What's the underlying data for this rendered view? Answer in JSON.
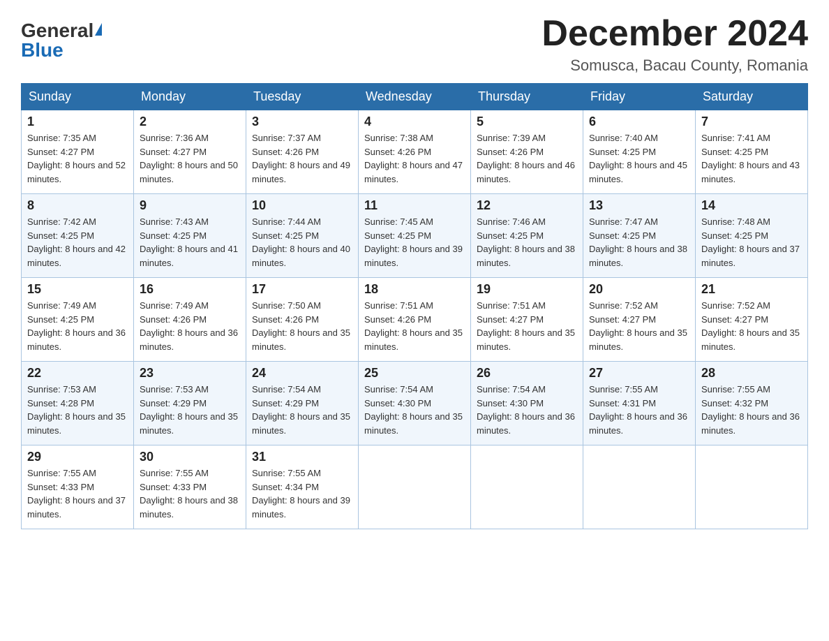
{
  "header": {
    "logo_general": "General",
    "logo_blue": "Blue",
    "month_title": "December 2024",
    "location": "Somusca, Bacau County, Romania"
  },
  "days_of_week": [
    "Sunday",
    "Monday",
    "Tuesday",
    "Wednesday",
    "Thursday",
    "Friday",
    "Saturday"
  ],
  "weeks": [
    [
      {
        "day": "1",
        "sunrise": "7:35 AM",
        "sunset": "4:27 PM",
        "daylight": "8 hours and 52 minutes."
      },
      {
        "day": "2",
        "sunrise": "7:36 AM",
        "sunset": "4:27 PM",
        "daylight": "8 hours and 50 minutes."
      },
      {
        "day": "3",
        "sunrise": "7:37 AM",
        "sunset": "4:26 PM",
        "daylight": "8 hours and 49 minutes."
      },
      {
        "day": "4",
        "sunrise": "7:38 AM",
        "sunset": "4:26 PM",
        "daylight": "8 hours and 47 minutes."
      },
      {
        "day": "5",
        "sunrise": "7:39 AM",
        "sunset": "4:26 PM",
        "daylight": "8 hours and 46 minutes."
      },
      {
        "day": "6",
        "sunrise": "7:40 AM",
        "sunset": "4:25 PM",
        "daylight": "8 hours and 45 minutes."
      },
      {
        "day": "7",
        "sunrise": "7:41 AM",
        "sunset": "4:25 PM",
        "daylight": "8 hours and 43 minutes."
      }
    ],
    [
      {
        "day": "8",
        "sunrise": "7:42 AM",
        "sunset": "4:25 PM",
        "daylight": "8 hours and 42 minutes."
      },
      {
        "day": "9",
        "sunrise": "7:43 AM",
        "sunset": "4:25 PM",
        "daylight": "8 hours and 41 minutes."
      },
      {
        "day": "10",
        "sunrise": "7:44 AM",
        "sunset": "4:25 PM",
        "daylight": "8 hours and 40 minutes."
      },
      {
        "day": "11",
        "sunrise": "7:45 AM",
        "sunset": "4:25 PM",
        "daylight": "8 hours and 39 minutes."
      },
      {
        "day": "12",
        "sunrise": "7:46 AM",
        "sunset": "4:25 PM",
        "daylight": "8 hours and 38 minutes."
      },
      {
        "day": "13",
        "sunrise": "7:47 AM",
        "sunset": "4:25 PM",
        "daylight": "8 hours and 38 minutes."
      },
      {
        "day": "14",
        "sunrise": "7:48 AM",
        "sunset": "4:25 PM",
        "daylight": "8 hours and 37 minutes."
      }
    ],
    [
      {
        "day": "15",
        "sunrise": "7:49 AM",
        "sunset": "4:25 PM",
        "daylight": "8 hours and 36 minutes."
      },
      {
        "day": "16",
        "sunrise": "7:49 AM",
        "sunset": "4:26 PM",
        "daylight": "8 hours and 36 minutes."
      },
      {
        "day": "17",
        "sunrise": "7:50 AM",
        "sunset": "4:26 PM",
        "daylight": "8 hours and 35 minutes."
      },
      {
        "day": "18",
        "sunrise": "7:51 AM",
        "sunset": "4:26 PM",
        "daylight": "8 hours and 35 minutes."
      },
      {
        "day": "19",
        "sunrise": "7:51 AM",
        "sunset": "4:27 PM",
        "daylight": "8 hours and 35 minutes."
      },
      {
        "day": "20",
        "sunrise": "7:52 AM",
        "sunset": "4:27 PM",
        "daylight": "8 hours and 35 minutes."
      },
      {
        "day": "21",
        "sunrise": "7:52 AM",
        "sunset": "4:27 PM",
        "daylight": "8 hours and 35 minutes."
      }
    ],
    [
      {
        "day": "22",
        "sunrise": "7:53 AM",
        "sunset": "4:28 PM",
        "daylight": "8 hours and 35 minutes."
      },
      {
        "day": "23",
        "sunrise": "7:53 AM",
        "sunset": "4:29 PM",
        "daylight": "8 hours and 35 minutes."
      },
      {
        "day": "24",
        "sunrise": "7:54 AM",
        "sunset": "4:29 PM",
        "daylight": "8 hours and 35 minutes."
      },
      {
        "day": "25",
        "sunrise": "7:54 AM",
        "sunset": "4:30 PM",
        "daylight": "8 hours and 35 minutes."
      },
      {
        "day": "26",
        "sunrise": "7:54 AM",
        "sunset": "4:30 PM",
        "daylight": "8 hours and 36 minutes."
      },
      {
        "day": "27",
        "sunrise": "7:55 AM",
        "sunset": "4:31 PM",
        "daylight": "8 hours and 36 minutes."
      },
      {
        "day": "28",
        "sunrise": "7:55 AM",
        "sunset": "4:32 PM",
        "daylight": "8 hours and 36 minutes."
      }
    ],
    [
      {
        "day": "29",
        "sunrise": "7:55 AM",
        "sunset": "4:33 PM",
        "daylight": "8 hours and 37 minutes."
      },
      {
        "day": "30",
        "sunrise": "7:55 AM",
        "sunset": "4:33 PM",
        "daylight": "8 hours and 38 minutes."
      },
      {
        "day": "31",
        "sunrise": "7:55 AM",
        "sunset": "4:34 PM",
        "daylight": "8 hours and 39 minutes."
      },
      null,
      null,
      null,
      null
    ]
  ]
}
